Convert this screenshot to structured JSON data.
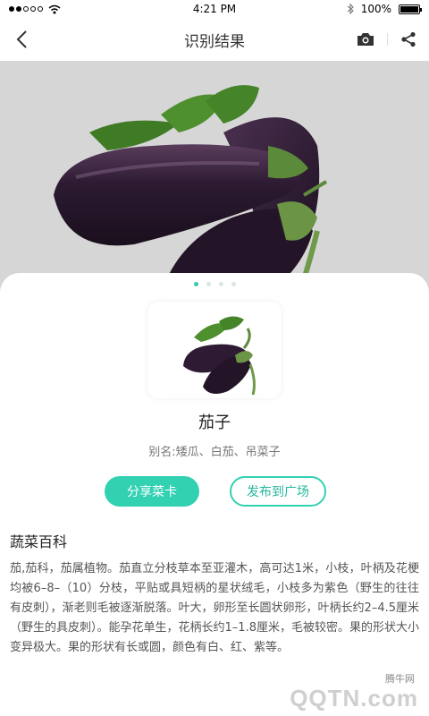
{
  "status_bar": {
    "time": "4:21 PM",
    "battery": "100%"
  },
  "nav": {
    "title": "识别结果"
  },
  "carousel": {
    "dot_count": 4,
    "active_index": 0
  },
  "result": {
    "name": "茄子",
    "alias": "别名:矮瓜、白茄、吊菜子"
  },
  "actions": {
    "share": "分享菜卡",
    "publish": "发布到广场"
  },
  "encyclopedia": {
    "title": "蔬菜百科",
    "text": "茄,茄科，茄属植物。茄直立分枝草本至亚灌木，高可达1米，小枝，叶柄及花梗均被6–8–（10）分枝，平贴或具短柄的星状绒毛，小枝多为紫色（野生的往往有皮刺），渐老则毛被逐渐脱落。叶大，卵形至长圆状卵形，叶柄长约2–4.5厘米（野生的具皮刺）。能孕花单生，花柄长约1–1.8厘米，毛被较密。果的形状大小变异极大。果的形状有长或圆，颜色有白、红、紫等。"
  },
  "watermark": {
    "small": "腾牛网",
    "big": "QQTN.com"
  },
  "colors": {
    "accent": "#32d1b2",
    "eggplant": "#3a2240",
    "leaf": "#4f8a2f"
  }
}
